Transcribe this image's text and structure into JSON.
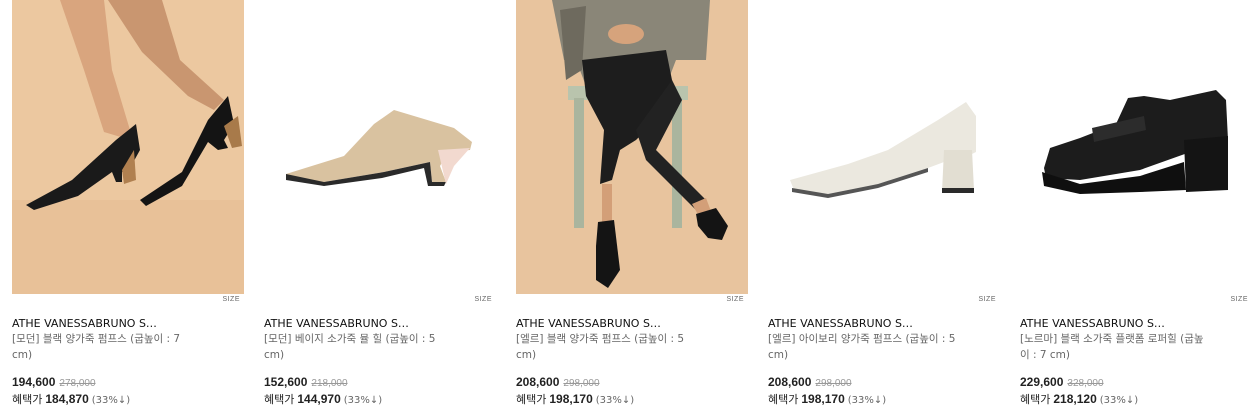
{
  "size_label": "SIZE",
  "products": [
    {
      "brand": "ATHE VANESSABRUNO S…",
      "name": "[모던] 블랙 양가죽 펌프스 (굽높이 : 7 cm)",
      "price": "194,600",
      "original_price": "278,000",
      "benefit_label": "혜택가",
      "benefit_price": "184,870",
      "benefit_rate": "(33%↓)",
      "image": "model-legs-black-pumps"
    },
    {
      "brand": "ATHE VANESSABRUNO S…",
      "name": "[모던] 베이지 소가죽 뮬 힐 (굽높이 : 5 cm)",
      "price": "152,600",
      "original_price": "218,000",
      "benefit_label": "혜택가",
      "benefit_price": "144,970",
      "benefit_rate": "(33%↓)",
      "image": "beige-mule-heel"
    },
    {
      "brand": "ATHE VANESSABRUNO S…",
      "name": "[엘르] 블랙 양가죽 펌프스 (굽높이 : 5 cm)",
      "price": "208,600",
      "original_price": "298,000",
      "benefit_label": "혜택가",
      "benefit_price": "198,170",
      "benefit_rate": "(33%↓)",
      "image": "seated-model-black-pumps"
    },
    {
      "brand": "ATHE VANESSABRUNO S…",
      "name": "[엘르] 아이보리 양가죽 펌프스 (굽높이 : 5 cm)",
      "price": "208,600",
      "original_price": "298,000",
      "benefit_label": "혜택가",
      "benefit_price": "198,170",
      "benefit_rate": "(33%↓)",
      "image": "ivory-pump"
    },
    {
      "brand": "ATHE VANESSABRUNO S…",
      "name": "[노르마] 블랙 소가죽 플랫폼 로퍼힐 (굽높이 : 7 cm)",
      "price": "229,600",
      "original_price": "328,000",
      "benefit_label": "혜택가",
      "benefit_price": "218,120",
      "benefit_rate": "(33%↓)",
      "image": "black-platform-loafer"
    }
  ]
}
